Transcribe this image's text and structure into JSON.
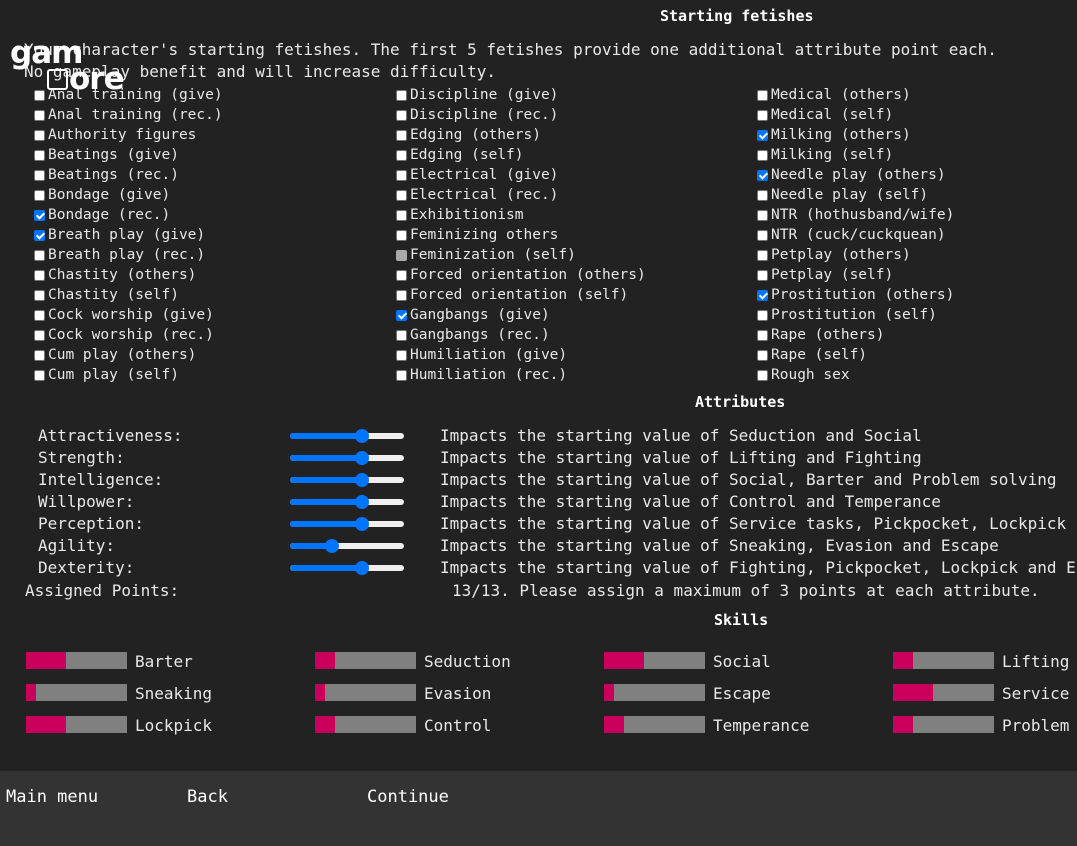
{
  "logo": {
    "line1": "gam",
    "line2": "ore"
  },
  "fetishes": {
    "title": "Starting fetishes",
    "intro_line1": "Your character's starting fetishes. The first 5 fetishes provide one additional attribute point each.",
    "intro_line2": "No gameplay benefit and will increase difficulty.",
    "columns": [
      [
        {
          "label": "Anal training (give)",
          "state": "unchecked"
        },
        {
          "label": "Anal training (rec.)",
          "state": "unchecked"
        },
        {
          "label": "Authority figures",
          "state": "unchecked"
        },
        {
          "label": "Beatings (give)",
          "state": "unchecked"
        },
        {
          "label": "Beatings (rec.)",
          "state": "unchecked"
        },
        {
          "label": "Bondage (give)",
          "state": "unchecked"
        },
        {
          "label": "Bondage (rec.)",
          "state": "checked"
        },
        {
          "label": "Breath play (give)",
          "state": "checked"
        },
        {
          "label": "Breath play (rec.)",
          "state": "unchecked"
        },
        {
          "label": "Chastity (others)",
          "state": "unchecked"
        },
        {
          "label": "Chastity (self)",
          "state": "unchecked"
        },
        {
          "label": "Cock worship (give)",
          "state": "unchecked"
        },
        {
          "label": "Cock worship (rec.)",
          "state": "unchecked"
        },
        {
          "label": "Cum play (others)",
          "state": "unchecked"
        },
        {
          "label": "Cum play (self)",
          "state": "unchecked"
        }
      ],
      [
        {
          "label": "Discipline (give)",
          "state": "unchecked"
        },
        {
          "label": "Discipline (rec.)",
          "state": "unchecked"
        },
        {
          "label": "Edging (others)",
          "state": "unchecked"
        },
        {
          "label": "Edging (self)",
          "state": "unchecked"
        },
        {
          "label": "Electrical (give)",
          "state": "unchecked"
        },
        {
          "label": "Electrical (rec.)",
          "state": "unchecked"
        },
        {
          "label": "Exhibitionism",
          "state": "unchecked"
        },
        {
          "label": "Feminizing others",
          "state": "unchecked"
        },
        {
          "label": "Feminization (self)",
          "state": "disabled"
        },
        {
          "label": "Forced orientation (others)",
          "state": "unchecked"
        },
        {
          "label": "Forced orientation (self)",
          "state": "unchecked"
        },
        {
          "label": "Gangbangs (give)",
          "state": "checked"
        },
        {
          "label": "Gangbangs (rec.)",
          "state": "unchecked"
        },
        {
          "label": "Humiliation (give)",
          "state": "unchecked"
        },
        {
          "label": "Humiliation (rec.)",
          "state": "unchecked"
        }
      ],
      [
        {
          "label": "Medical (others)",
          "state": "unchecked"
        },
        {
          "label": "Medical (self)",
          "state": "unchecked"
        },
        {
          "label": "Milking (others)",
          "state": "checked"
        },
        {
          "label": "Milking (self)",
          "state": "unchecked"
        },
        {
          "label": "Needle play (others)",
          "state": "checked"
        },
        {
          "label": "Needle play (self)",
          "state": "unchecked"
        },
        {
          "label": "NTR (hothusband/wife)",
          "state": "unchecked"
        },
        {
          "label": "NTR (cuck/cuckquean)",
          "state": "unchecked"
        },
        {
          "label": "Petplay (others)",
          "state": "unchecked"
        },
        {
          "label": "Petplay (self)",
          "state": "unchecked"
        },
        {
          "label": "Prostitution (others)",
          "state": "checked"
        },
        {
          "label": "Prostitution (self)",
          "state": "unchecked"
        },
        {
          "label": "Rape (others)",
          "state": "unchecked"
        },
        {
          "label": "Rape (self)",
          "state": "unchecked"
        },
        {
          "label": "Rough sex",
          "state": "unchecked"
        }
      ]
    ]
  },
  "attributes": {
    "title": "Attributes",
    "items": [
      {
        "label": "Attractiveness:",
        "value": 0.65,
        "desc": "Impacts the starting value of Seduction and Social"
      },
      {
        "label": "Strength:",
        "value": 0.65,
        "desc": "Impacts the starting value of Lifting and Fighting"
      },
      {
        "label": "Intelligence:",
        "value": 0.65,
        "desc": "Impacts the starting value of Social, Barter and Problem solving"
      },
      {
        "label": "Willpower:",
        "value": 0.65,
        "desc": "Impacts the starting value of Control and Temperance"
      },
      {
        "label": "Perception:",
        "value": 0.65,
        "desc": "Impacts the starting value of Service tasks, Pickpocket, Lockpick"
      },
      {
        "label": "Agility:",
        "value": 0.35,
        "desc": "Impacts the starting value of Sneaking, Evasion and Escape"
      },
      {
        "label": "Dexterity:",
        "value": 0.65,
        "desc": "Impacts the starting value of Fighting, Pickpocket, Lockpick and Escape"
      }
    ],
    "assigned_label": "Assigned Points:",
    "assigned_value": "13/13. Please assign a maximum of 3 points at each attribute."
  },
  "skills": {
    "title": "Skills",
    "items": [
      {
        "name": "Barter",
        "value": 0.4
      },
      {
        "name": "Seduction",
        "value": 0.2
      },
      {
        "name": "Social",
        "value": 0.4
      },
      {
        "name": "Lifting",
        "value": 0.2
      },
      {
        "name": "Sneaking",
        "value": 0.1
      },
      {
        "name": "Evasion",
        "value": 0.1
      },
      {
        "name": "Escape",
        "value": 0.1
      },
      {
        "name": "Service",
        "value": 0.4
      },
      {
        "name": "Lockpick",
        "value": 0.4
      },
      {
        "name": "Control",
        "value": 0.2
      },
      {
        "name": "Temperance",
        "value": 0.2
      },
      {
        "name": "Problem",
        "value": 0.2
      }
    ]
  },
  "menu": {
    "main_menu": "Main menu",
    "back": "Back",
    "continue": "Continue"
  },
  "colors": {
    "background": "#222222",
    "footer": "#333333",
    "accent_blue": "#0075ff",
    "skill_fill": "#c8005c",
    "skill_track": "#808080"
  }
}
